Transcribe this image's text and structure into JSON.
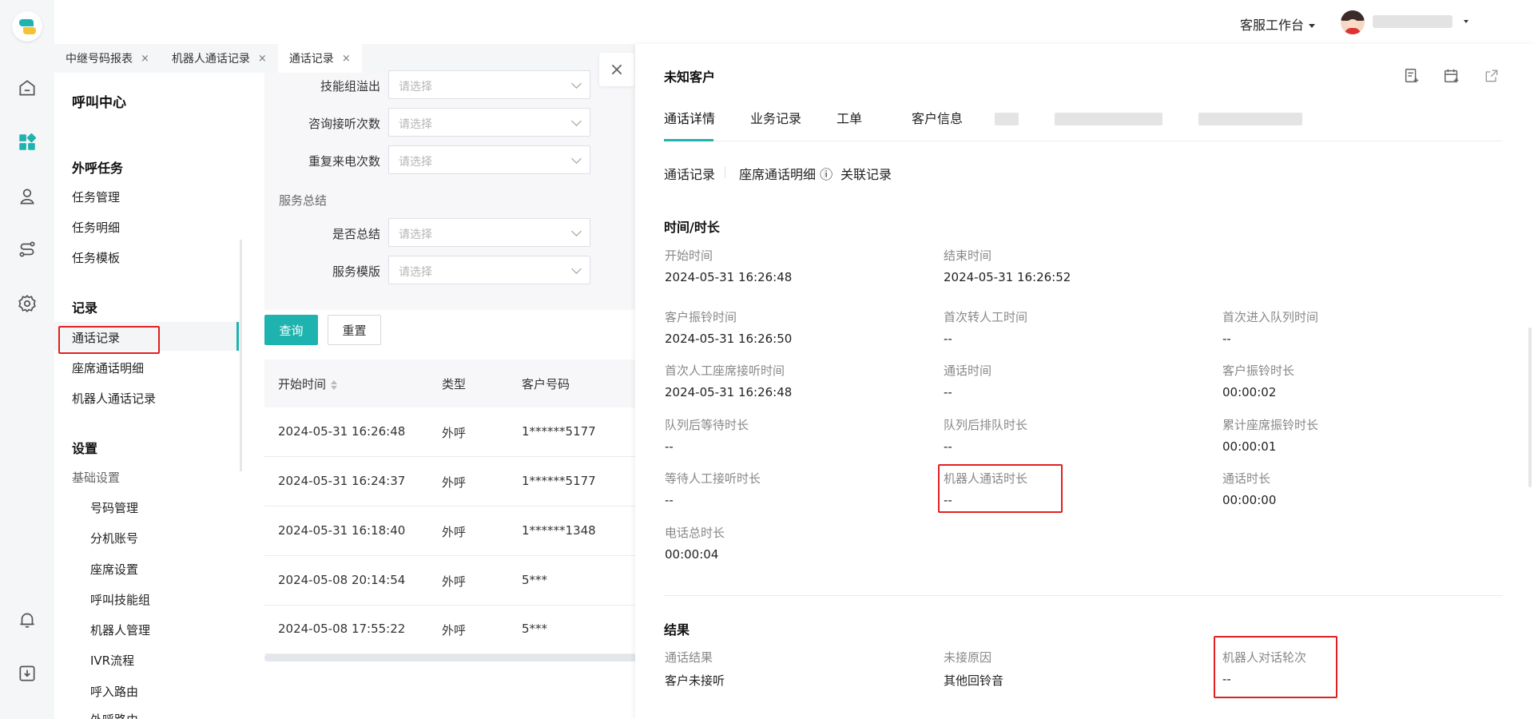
{
  "header": {
    "workspace": "客服工作台"
  },
  "tabs": [
    {
      "label": "中继号码报表",
      "close": "×"
    },
    {
      "label": "机器人通话记录",
      "close": "×"
    },
    {
      "label": "通话记录",
      "close": "×"
    }
  ],
  "nav": {
    "title": "呼叫中心",
    "groups": {
      "outbound": "外呼任务",
      "task_mgmt": "任务管理",
      "task_detail": "任务明细",
      "task_template": "任务模板",
      "records": "记录",
      "call_records": "通话记录",
      "seat_detail": "座席通话明细",
      "robot_records": "机器人通话记录",
      "settings": "设置",
      "basic": "基础设置",
      "numbers": "号码管理",
      "ext": "分机账号",
      "seat_settings": "座席设置",
      "skill_group": "呼叫技能组",
      "robot_mgmt": "机器人管理",
      "ivr": "IVR流程",
      "inbound_route": "呼入路由",
      "outbound_route": "外呼路由"
    }
  },
  "filters": {
    "placeholder": "请选择",
    "skill_overflow": "技能组溢出",
    "consult_count": "咨询接听次数",
    "repeat_count": "重复来电次数",
    "service_summary": "服务总结",
    "is_summary": "是否总结",
    "service_template": "服务模版"
  },
  "buttons": {
    "query": "查询",
    "reset": "重置"
  },
  "table": {
    "headers": [
      "开始时间",
      "类型",
      "客户号码"
    ],
    "rows": [
      [
        "2024-05-31 16:26:48",
        "外呼",
        "1******5177"
      ],
      [
        "2024-05-31 16:24:37",
        "外呼",
        "1******5177"
      ],
      [
        "2024-05-31 16:18:40",
        "外呼",
        "1******1348"
      ],
      [
        "2024-05-08 20:14:54",
        "外呼",
        "5***"
      ],
      [
        "2024-05-08 17:55:22",
        "外呼",
        "5***"
      ]
    ]
  },
  "drawer": {
    "close": "×",
    "title": "未知客户",
    "tabs": [
      "通话详情",
      "业务记录",
      "工单",
      "客户信息"
    ],
    "sub_tabs": [
      "通话记录",
      "座席通话明细",
      "关联记录"
    ],
    "info_icon": "ⓘ",
    "time_section": "时间/时长",
    "fields": [
      {
        "k": "开始时间",
        "v": "2024-05-31 16:26:48"
      },
      {
        "k": "结束时间",
        "v": "2024-05-31 16:26:52"
      },
      {
        "k": "客户振铃时间",
        "v": "2024-05-31 16:26:50"
      },
      {
        "k": "首次转人工时间",
        "v": "--"
      },
      {
        "k": "首次进入队列时间",
        "v": "--"
      },
      {
        "k": "首次人工座席接听时间",
        "v": "2024-05-31 16:26:48"
      },
      {
        "k": "通话时间",
        "v": "--"
      },
      {
        "k": "客户振铃时长",
        "v": "00:00:02"
      },
      {
        "k": "队列后等待时长",
        "v": "--"
      },
      {
        "k": "队列后排队时长",
        "v": "--"
      },
      {
        "k": "累计座席振铃时长",
        "v": "00:00:01"
      },
      {
        "k": "等待人工接听时长",
        "v": "--"
      },
      {
        "k": "机器人通话时长",
        "v": "--"
      },
      {
        "k": "通话时长",
        "v": "00:00:00"
      },
      {
        "k": "电话总时长",
        "v": "00:00:04"
      }
    ],
    "result_section": "结果",
    "results": [
      {
        "k": "通话结果",
        "v": "客户未接听"
      },
      {
        "k": "未接原因",
        "v": "其他回铃音"
      },
      {
        "k": "机器人对话轮次",
        "v": "--"
      }
    ]
  },
  "colors": {
    "accent": "#1fb3b0",
    "highlight": "#e02020"
  }
}
